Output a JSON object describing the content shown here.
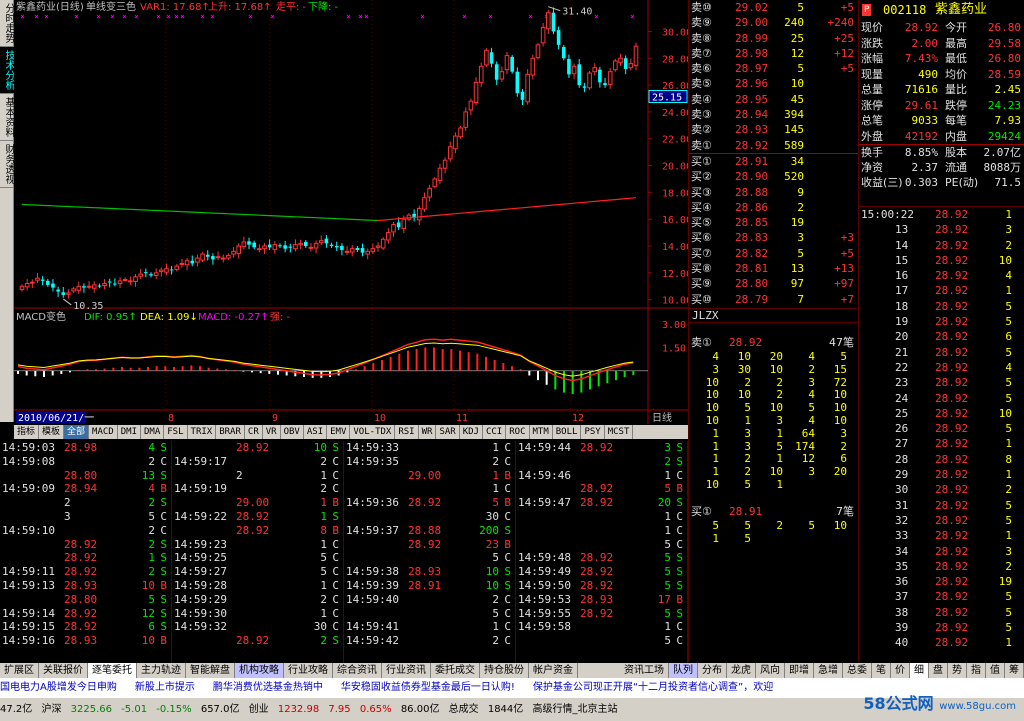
{
  "left_tabs": [
    {
      "label": "分时走势",
      "active": false
    },
    {
      "label": "技术分析",
      "active": true
    },
    {
      "label": "基本资料",
      "active": false
    },
    {
      "label": "财务透视",
      "active": false
    }
  ],
  "chart_header": {
    "name": "紫鑫药业(日线)",
    "mode": "单线变三色",
    "var1": "VAR1: 17.68↑",
    "up": "上升: 17.68↑",
    "flat": "走平: -",
    "down": "下降: -"
  },
  "macd_header": {
    "name": "MACD变色",
    "dif": "DIF: 0.95↑",
    "dea": "DEA: 1.09↓",
    "macd": "MACD: -0.27↑",
    "strong": "强: -"
  },
  "chart_data": {
    "type": "candlestick",
    "price_axis_ticks": [
      "30.00",
      "28.00",
      "26.00",
      "24.00",
      "22.00",
      "20.00",
      "18.00",
      "16.00",
      "14.00",
      "12.00",
      "10.00"
    ],
    "price_ylim": [
      9.6,
      31.6
    ],
    "current_price_tag": "25.15",
    "max_label": "31.40",
    "min_label": "10.35",
    "macd_axis_ticks": [
      "3.00",
      "1.50"
    ],
    "macd_ylim": [
      -2.2,
      3.4
    ],
    "date_label": "2010/06/21/一",
    "month_labels": [
      "8",
      "9",
      "10",
      "11",
      "12"
    ],
    "period_label": "日线",
    "closes": [
      11.0,
      11.2,
      11.3,
      11.6,
      11.4,
      11.1,
      10.9,
      10.6,
      10.35,
      10.5,
      10.8,
      11.0,
      10.9,
      11.0,
      11.1,
      11.0,
      11.2,
      11.3,
      11.2,
      11.4,
      11.5,
      11.4,
      11.7,
      11.9,
      12.0,
      11.8,
      12.0,
      12.2,
      12.3,
      12.2,
      12.5,
      12.7,
      12.9,
      12.7,
      13.1,
      13.4,
      13.2,
      13.0,
      13.2,
      13.1,
      13.3,
      13.6,
      14.0,
      14.3,
      14.1,
      13.9,
      13.8,
      14.0,
      13.9,
      14.1,
      14.0,
      13.8,
      13.9,
      14.1,
      14.2,
      14.0,
      13.9,
      14.2,
      14.4,
      14.2,
      14.0,
      13.9,
      13.7,
      13.6,
      13.8,
      13.7,
      13.5,
      13.6,
      13.8,
      14.0,
      14.5,
      15.0,
      15.6,
      15.4,
      16.0,
      16.3,
      16.1,
      16.8,
      17.6,
      18.3,
      19.0,
      19.8,
      20.4,
      21.4,
      22.2,
      22.8,
      24.0,
      24.8,
      26.2,
      27.4,
      28.6,
      27.6,
      26.4,
      27.0,
      28.2,
      27.0,
      25.4,
      24.9,
      26.8,
      28.0,
      29.0,
      30.3,
      31.4,
      30.0,
      29.0,
      28.0,
      26.8,
      27.4,
      26.0,
      25.8,
      26.9,
      27.3,
      26.2,
      26.0,
      27.0,
      27.8,
      28.0,
      27.2,
      27.6,
      28.9
    ],
    "ma_line_start": 17.1,
    "ma_line_min": 15.9,
    "ma_line_end": 17.6,
    "macd_bars": [
      -0.2,
      -0.3,
      -0.35,
      -0.4,
      -0.3,
      -0.2,
      -0.1,
      0.05,
      0.1,
      0.1,
      0.15,
      0.2,
      0.25,
      0.2,
      0.2,
      0.25,
      0.3,
      0.3,
      0.25,
      0.3,
      0.35,
      0.3,
      0.2,
      0.15,
      0.1,
      0.05,
      -0.05,
      -0.1,
      -0.15,
      -0.2,
      -0.25,
      -0.3,
      -0.35,
      -0.4,
      -0.45,
      -0.45,
      -0.4,
      -0.3,
      -0.1,
      0.1,
      0.3,
      0.5,
      0.7,
      0.9,
      1.1,
      1.3,
      1.4,
      1.5,
      1.5,
      1.4,
      1.4,
      1.3,
      1.2,
      1.1,
      0.9,
      0.7,
      0.5,
      0.3,
      0.1,
      -0.3,
      -0.6,
      -0.9,
      -1.2,
      -1.4,
      -1.5,
      -1.4,
      -1.2,
      -1.0,
      -0.8,
      -0.6,
      -0.4,
      -0.27
    ]
  },
  "index_tabs": [
    "指标",
    "模板",
    "全部",
    "MACD",
    "DMI",
    "DMA",
    "FSL",
    "TRIX",
    "BRAR",
    "CR",
    "VR",
    "OBV",
    "ASI",
    "EMV",
    "VOL-TDX",
    "RSI",
    "WR",
    "SAR",
    "KDJ",
    "CCI",
    "ROC",
    "MTM",
    "BOLL",
    "PSY",
    "MCST"
  ],
  "tick_columns": [
    [
      [
        "14:59:03",
        "28.98",
        "4",
        "S"
      ],
      [
        "14:59:08",
        "",
        "2",
        "C"
      ],
      [
        "",
        "28.80",
        "13",
        "S"
      ],
      [
        "14:59:09",
        "28.94",
        "4",
        "B"
      ],
      [
        "",
        "2",
        "2",
        "S"
      ],
      [
        "",
        "3",
        "5",
        "C"
      ],
      [
        "14:59:10",
        "",
        "2",
        "C"
      ],
      [
        "",
        "28.92",
        "2",
        "S"
      ],
      [
        "",
        "28.92",
        "1",
        "S"
      ],
      [
        "14:59:11",
        "28.92",
        "2",
        "S"
      ],
      [
        "14:59:13",
        "28.93",
        "10",
        "B"
      ],
      [
        "",
        "28.80",
        "5",
        "S"
      ],
      [
        "14:59:14",
        "28.92",
        "12",
        "S"
      ],
      [
        "14:59:15",
        "28.92",
        "6",
        "S"
      ],
      [
        "14:59:16",
        "28.93",
        "10",
        "B"
      ]
    ],
    [
      [
        "",
        "28.92",
        "10",
        "S"
      ],
      [
        "14:59:17",
        "",
        "2",
        "C"
      ],
      [
        "",
        "2",
        "1",
        "C"
      ],
      [
        "14:59:19",
        "",
        "2",
        "C"
      ],
      [
        "",
        "29.00",
        "1",
        "B"
      ],
      [
        "14:59:22",
        "28.92",
        "1",
        "S"
      ],
      [
        "",
        "28.92",
        "8",
        "B"
      ],
      [
        "14:59:23",
        "",
        "1",
        "C"
      ],
      [
        "14:59:25",
        "",
        "5",
        "C"
      ],
      [
        "14:59:27",
        "",
        "5",
        "C"
      ],
      [
        "14:59:28",
        "",
        "1",
        "C"
      ],
      [
        "14:59:29",
        "",
        "2",
        "C"
      ],
      [
        "14:59:30",
        "",
        "1",
        "C"
      ],
      [
        "14:59:32",
        "",
        "30",
        "C"
      ],
      [
        "",
        "28.92",
        "2",
        "S"
      ]
    ],
    [
      [
        "14:59:33",
        "",
        "1",
        "C"
      ],
      [
        "14:59:35",
        "",
        "2",
        "C"
      ],
      [
        "",
        "29.00",
        "1",
        "B"
      ],
      [
        "",
        "",
        "1",
        "C"
      ],
      [
        "14:59:36",
        "28.92",
        "5",
        "B"
      ],
      [
        "",
        "",
        "30",
        "C"
      ],
      [
        "14:59:37",
        "28.88",
        "200",
        "S"
      ],
      [
        "",
        "28.92",
        "23",
        "B"
      ],
      [
        "",
        "",
        "5",
        "C"
      ],
      [
        "14:59:38",
        "28.93",
        "10",
        "S"
      ],
      [
        "14:59:39",
        "28.91",
        "10",
        "S"
      ],
      [
        "14:59:40",
        "",
        "2",
        "C"
      ],
      [
        "",
        "",
        "5",
        "C"
      ],
      [
        "14:59:41",
        "",
        "1",
        "C"
      ],
      [
        "14:59:42",
        "",
        "2",
        "C"
      ]
    ],
    [
      [
        "14:59:44",
        "28.92",
        "3",
        "S"
      ],
      [
        "",
        "",
        "2",
        "S"
      ],
      [
        "14:59:46",
        "",
        "1",
        "C"
      ],
      [
        "",
        "28.92",
        "5",
        "B"
      ],
      [
        "14:59:47",
        "28.92",
        "20",
        "S"
      ],
      [
        "",
        "",
        "1",
        "C"
      ],
      [
        "",
        "",
        "1",
        "C"
      ],
      [
        "",
        "",
        "5",
        "C"
      ],
      [
        "14:59:48",
        "28.92",
        "5",
        "S"
      ],
      [
        "14:59:49",
        "28.92",
        "5",
        "S"
      ],
      [
        "14:59:50",
        "28.92",
        "5",
        "S"
      ],
      [
        "14:59:53",
        "28.93",
        "17",
        "B"
      ],
      [
        "14:59:55",
        "28.92",
        "5",
        "S"
      ],
      [
        "14:59:58",
        "",
        "1",
        "C"
      ],
      [
        "",
        "",
        "5",
        "C"
      ]
    ]
  ],
  "order_book": {
    "sell": [
      [
        "卖⑩",
        "29.02",
        "5",
        "+5"
      ],
      [
        "卖⑨",
        "29.00",
        "240",
        "+240"
      ],
      [
        "卖⑧",
        "28.99",
        "25",
        "+25"
      ],
      [
        "卖⑦",
        "28.98",
        "12",
        "+12"
      ],
      [
        "卖⑥",
        "28.97",
        "5",
        "+5"
      ],
      [
        "卖⑤",
        "28.96",
        "10",
        ""
      ],
      [
        "卖④",
        "28.95",
        "45",
        ""
      ],
      [
        "卖③",
        "28.94",
        "394",
        ""
      ],
      [
        "卖②",
        "28.93",
        "145",
        ""
      ],
      [
        "卖①",
        "28.92",
        "589",
        ""
      ]
    ],
    "buy": [
      [
        "买①",
        "28.91",
        "34",
        ""
      ],
      [
        "买②",
        "28.90",
        "520",
        ""
      ],
      [
        "买③",
        "28.88",
        "9",
        ""
      ],
      [
        "买④",
        "28.86",
        "2",
        ""
      ],
      [
        "买⑤",
        "28.85",
        "19",
        ""
      ],
      [
        "买⑥",
        "28.83",
        "3",
        "+3"
      ],
      [
        "买⑦",
        "28.82",
        "5",
        "+5"
      ],
      [
        "买⑧",
        "28.81",
        "13",
        "+13"
      ],
      [
        "买⑨",
        "28.80",
        "97",
        "+97"
      ],
      [
        "买⑩",
        "28.79",
        "7",
        "+7"
      ]
    ]
  },
  "stock": {
    "code": "002118",
    "name": "紫鑫药业",
    "flag": "P"
  },
  "quote_rows": [
    [
      "现价",
      "28.92",
      "今开",
      "26.80"
    ],
    [
      "涨跌",
      "2.00",
      "最高",
      "29.58"
    ],
    [
      "涨幅",
      "7.43%",
      "最低",
      "26.80"
    ],
    [
      "现量",
      "490",
      "均价",
      "28.59"
    ],
    [
      "总量",
      "71616",
      "量比",
      "2.45"
    ],
    [
      "涨停",
      "29.61",
      "跌停",
      "24.23"
    ],
    [
      "总笔",
      "9033",
      "每笔",
      "7.93"
    ],
    [
      "外盘",
      "42192",
      "内盘",
      "29424"
    ],
    [
      "换手",
      "8.85%",
      "股本",
      "2.07亿"
    ],
    [
      "净资",
      "2.37",
      "流通",
      "8088万"
    ],
    [
      "收益(三)",
      "0.303",
      "PE(动)",
      "71.5"
    ]
  ],
  "jlzx": {
    "title": "JLZX",
    "sell_head": [
      "卖①",
      "28.92",
      "47笔"
    ],
    "sell_grid": [
      [
        "4",
        "10",
        "20",
        "4",
        "5"
      ],
      [
        "3",
        "30",
        "10",
        "2",
        "15"
      ],
      [
        "10",
        "2",
        "2",
        "3",
        "72"
      ],
      [
        "10",
        "10",
        "2",
        "4",
        "10"
      ],
      [
        "10",
        "5",
        "10",
        "5",
        "10"
      ],
      [
        "10",
        "1",
        "3",
        "4",
        "10"
      ],
      [
        "1",
        "3",
        "1",
        "64",
        "3"
      ],
      [
        "1",
        "3",
        "5",
        "174",
        "2"
      ],
      [
        "1",
        "2",
        "1",
        "12",
        "6"
      ],
      [
        "1",
        "2",
        "10",
        "3",
        "20"
      ],
      [
        "10",
        "5",
        "1",
        "",
        ""
      ]
    ],
    "buy_head": [
      "买①",
      "28.91",
      "7笔"
    ],
    "buy_grid": [
      [
        "5",
        "5",
        "2",
        "5",
        "10"
      ],
      [
        "1",
        "5",
        "",
        "",
        ""
      ]
    ]
  },
  "quote_ticks": {
    "first_time": "15:00:22",
    "rows": [
      [
        "15:00:22",
        "28.92",
        "1"
      ],
      [
        "13",
        "28.92",
        "3"
      ],
      [
        "14",
        "28.92",
        "2"
      ],
      [
        "15",
        "28.92",
        "10"
      ],
      [
        "16",
        "28.92",
        "4"
      ],
      [
        "17",
        "28.92",
        "1"
      ],
      [
        "18",
        "28.92",
        "5"
      ],
      [
        "19",
        "28.92",
        "5"
      ],
      [
        "20",
        "28.92",
        "6"
      ],
      [
        "21",
        "28.92",
        "5"
      ],
      [
        "22",
        "28.92",
        "4"
      ],
      [
        "23",
        "28.92",
        "5"
      ],
      [
        "24",
        "28.92",
        "5"
      ],
      [
        "25",
        "28.92",
        "10"
      ],
      [
        "26",
        "28.92",
        "5"
      ],
      [
        "27",
        "28.92",
        "1"
      ],
      [
        "28",
        "28.92",
        "8"
      ],
      [
        "29",
        "28.92",
        "1"
      ],
      [
        "30",
        "28.92",
        "2"
      ],
      [
        "31",
        "28.92",
        "5"
      ],
      [
        "32",
        "28.92",
        "5"
      ],
      [
        "33",
        "28.92",
        "1"
      ],
      [
        "34",
        "28.92",
        "3"
      ],
      [
        "35",
        "28.92",
        "2"
      ],
      [
        "36",
        "28.92",
        "19"
      ],
      [
        "37",
        "28.92",
        "5"
      ],
      [
        "38",
        "28.92",
        "5"
      ],
      [
        "39",
        "28.92",
        "5"
      ],
      [
        "40",
        "28.92",
        "1"
      ]
    ]
  },
  "func_bar": [
    "扩展区",
    "关联报价",
    "逐笔委托",
    "主力轨迹",
    "智能解盘",
    "机构攻略",
    "行业攻略",
    "综合资讯",
    "行业资讯",
    "委托成交",
    "持仓股份",
    "帐户资金"
  ],
  "func_bar_right": [
    "资讯工场",
    "队列",
    "分布",
    "龙虎",
    "风向",
    "即增",
    "急增",
    "总委",
    "笔",
    "价",
    "细",
    "盘",
    "势",
    "指",
    "值",
    "筹"
  ],
  "news": [
    "国电电力A股增发今日申购",
    "新股上市提示",
    "鹏华消费优选基金热销中",
    "华安稳固收益债券型基金最后一日认购!",
    "保护基金公司现正开展“十二月投资者信心调查”，欢迎"
  ],
  "status": {
    "sh": "47.2亿",
    "sz_label": "沪深",
    "sz_value": "3225.66",
    "sz_chg": "-5.01",
    "sz_pct": "-0.15%",
    "sz_amt": "657.0亿",
    "cy_label": "创业",
    "cy_value": "1232.98",
    "cy_chg": "7.95",
    "cy_pct": "0.65%",
    "cy_amt": "86.00亿",
    "total_label": "总成交",
    "total_value": "1844亿",
    "site": "高级行情_北京主站"
  },
  "brand": {
    "name": "58公式网",
    "url": "www.58gu.com"
  }
}
